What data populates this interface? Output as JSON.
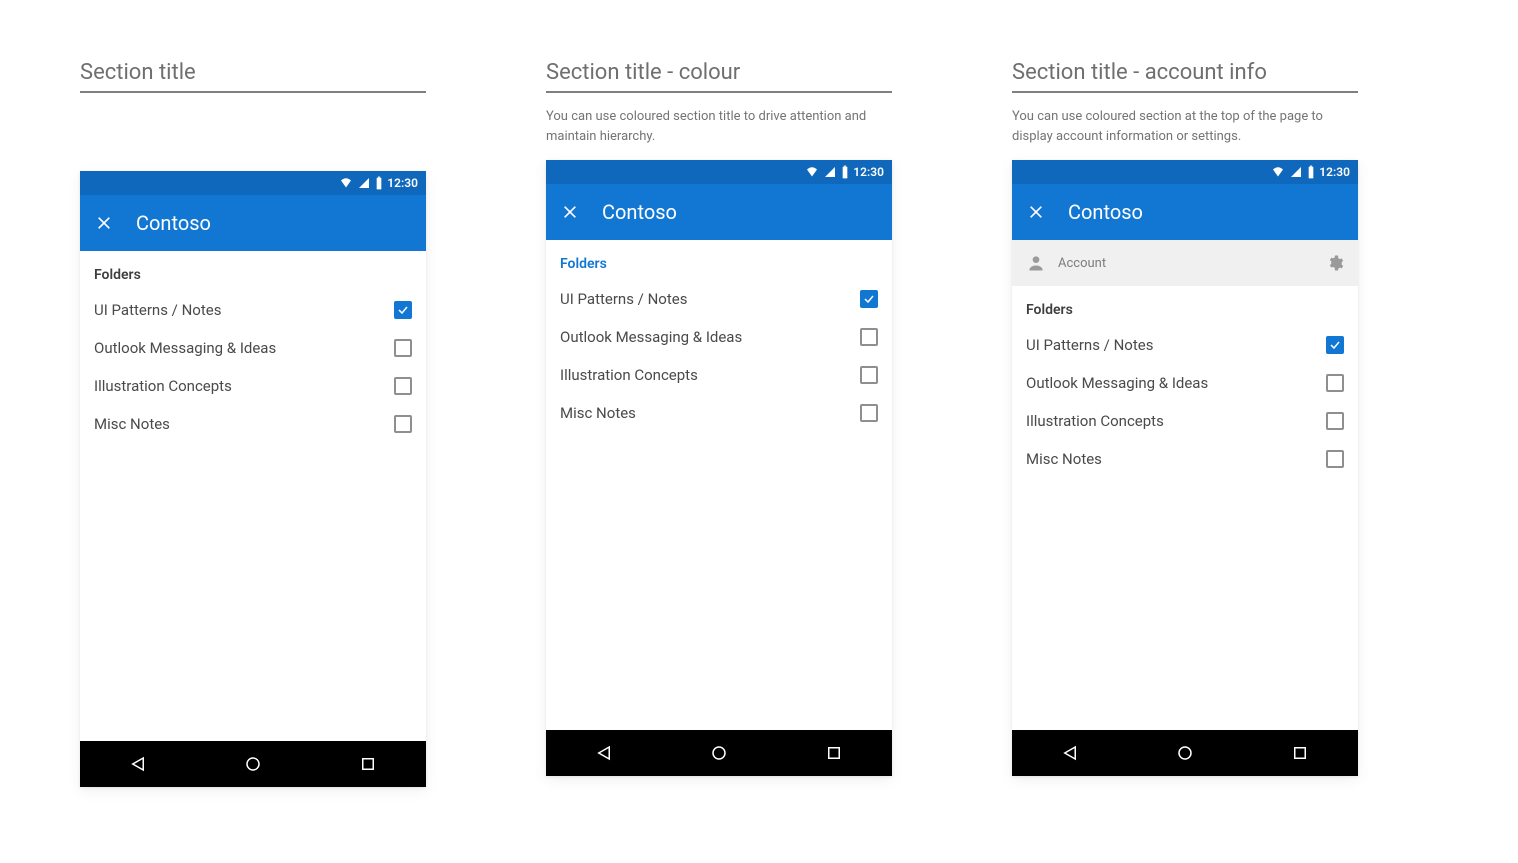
{
  "columns": [
    {
      "heading": "Section title",
      "desc": "",
      "sectionHeader": "Folders",
      "sectionHeaderStyle": "black",
      "hasAccountRow": false
    },
    {
      "heading": "Section title - colour",
      "desc": "You can use coloured section title to drive attention and maintain hierarchy.",
      "sectionHeader": "Folders",
      "sectionHeaderStyle": "blue",
      "hasAccountRow": false
    },
    {
      "heading": "Section title - account info",
      "desc": "You can use coloured section at the top of the page to display account information or settings.",
      "sectionHeader": "Folders",
      "sectionHeaderStyle": "black",
      "hasAccountRow": true,
      "accountLabel": "Account"
    }
  ],
  "statusbarTime": "12:30",
  "appTitle": "Contoso",
  "items": [
    {
      "label": "UI Patterns / Notes",
      "checked": true
    },
    {
      "label": "Outlook Messaging & Ideas",
      "checked": false
    },
    {
      "label": "Illustration Concepts",
      "checked": false
    },
    {
      "label": "Misc Notes",
      "checked": false
    }
  ]
}
